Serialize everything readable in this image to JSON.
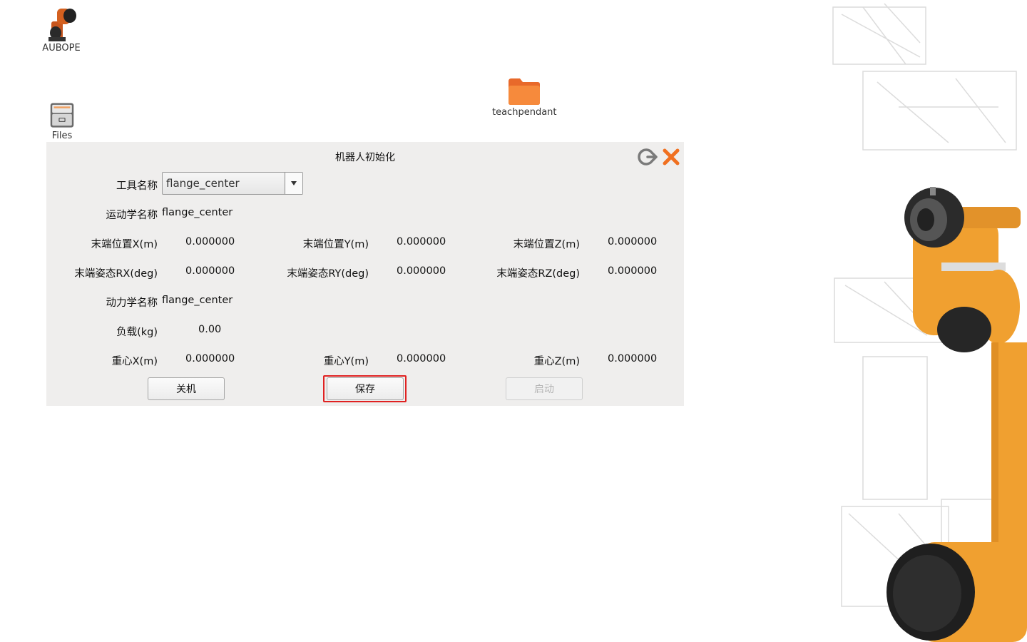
{
  "desktop": {
    "icons": [
      {
        "label": "AUBOPE"
      },
      {
        "label": "Files"
      },
      {
        "label": "teachpendant"
      }
    ]
  },
  "dialog": {
    "title": "机器人初始化",
    "tool_name_label": "工具名称",
    "tool_name_value": "flange_center",
    "kinematics_label": "运动学名称",
    "kinematics_value": "flange_center",
    "end_pos_x_label": "末端位置X(m)",
    "end_pos_x_value": "0.000000",
    "end_pos_y_label": "末端位置Y(m)",
    "end_pos_y_value": "0.000000",
    "end_pos_z_label": "末端位置Z(m)",
    "end_pos_z_value": "0.000000",
    "end_rx_label": "末端姿态RX(deg)",
    "end_rx_value": "0.000000",
    "end_ry_label": "末端姿态RY(deg)",
    "end_ry_value": "0.000000",
    "end_rz_label": "末端姿态RZ(deg)",
    "end_rz_value": "0.000000",
    "dynamics_label": "动力学名称",
    "dynamics_value": "flange_center",
    "payload_label": "负载(kg)",
    "payload_value": "0.00",
    "cog_x_label": "重心X(m)",
    "cog_x_value": "0.000000",
    "cog_y_label": "重心Y(m)",
    "cog_y_value": "0.000000",
    "cog_z_label": "重心Z(m)",
    "cog_z_value": "0.000000",
    "shutdown_label": "关机",
    "save_label": "保存",
    "start_label": "启动"
  },
  "colors": {
    "dialog_bg": "#efeeed",
    "close_icon": "#f07020",
    "highlight": "#e02121",
    "robot_orange": "#f0a030"
  }
}
